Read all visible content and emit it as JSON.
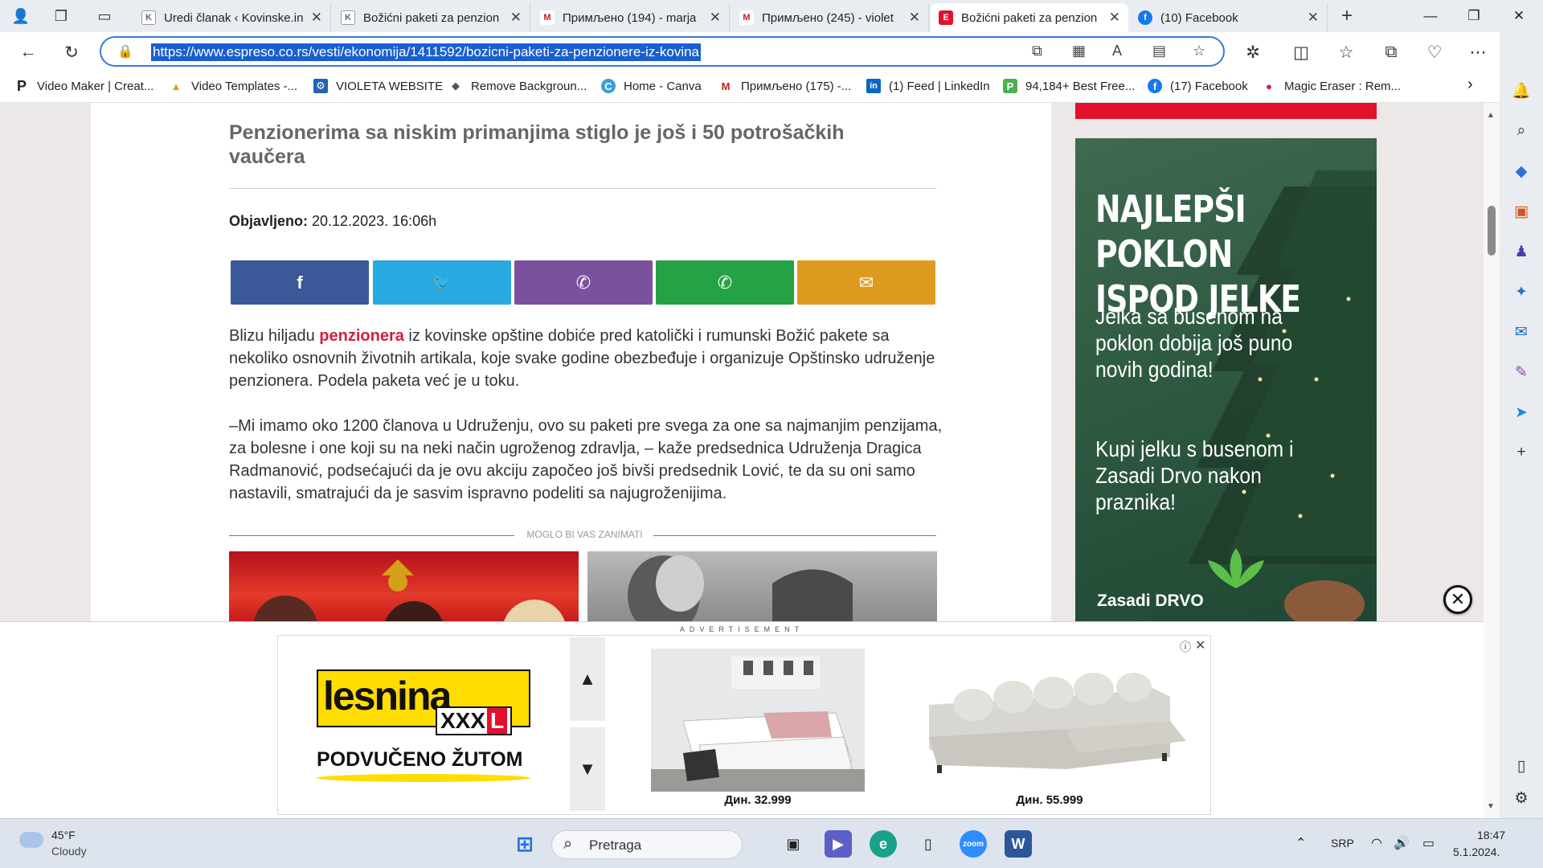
{
  "tabs": [
    {
      "title": "Uredi članak ‹ Kovinske.in",
      "favicon": "K"
    },
    {
      "title": "Božićni paketi za penzion",
      "favicon": "K"
    },
    {
      "title": "Примљено (194) - marja",
      "favicon": "M"
    },
    {
      "title": "Примљено (245) - violet",
      "favicon": "M"
    },
    {
      "title": "Božićni paketi za penzion",
      "favicon": "E",
      "active": true
    },
    {
      "title": "(10) Facebook",
      "favicon": "f"
    }
  ],
  "address": {
    "url": "https://www.espreso.co.rs/vesti/ekonomija/1411592/bozicni-paketi-za-penzionere-iz-kovina"
  },
  "bookmarks": [
    {
      "label": "Video Maker | Creat...",
      "icon": "P"
    },
    {
      "label": "Video Templates -...",
      "icon": "▲"
    },
    {
      "label": "VIOLETA WEBSITE",
      "icon": "⚙"
    },
    {
      "label": "Remove Backgroun...",
      "icon": "◆"
    },
    {
      "label": "Home - Canva",
      "icon": "C"
    },
    {
      "label": "Примљено (175) -...",
      "icon": "M"
    },
    {
      "label": "(1) Feed | LinkedIn",
      "icon": "in"
    },
    {
      "label": "94,184+ Best Free...",
      "icon": "P"
    },
    {
      "label": "(17) Facebook",
      "icon": "f"
    },
    {
      "label": "Magic Eraser : Rem...",
      "icon": "●"
    }
  ],
  "article": {
    "headline": "Penzionerima sa niskim primanjima stiglo je još i 50 potrošačkih vaučera",
    "published_label": "Objavljeno:",
    "published_value": " 20.12.2023. 16:06h",
    "para1_before": "Blizu hiljadu ",
    "para1_link": "penzionera",
    "para1_after": " iz kovinske opštine dobiće pred katolički i rumunski Božić pakete sa nekoliko osnovnih životnih artikala, koje svake godine obezbeđuje i organizuje Opštinsko udruženje penzionera. Podela paketa već je u toku.",
    "para2": "–Mi imamo oko 1200 članova u Udruženju, ovo su paketi pre svega za one sa najmanjim penzijama, za bolesne i one koji su na neki način ugroženog zdravlja, – kaže predsednica Udruženja Dragica Radmanović, podsećajući da je ovu akciju započeo još bivši predsednik Lović, te da su oni samo nastavili, smatrajući da je sasvim ispravno podeliti sa najugroženijima.",
    "related_label": "MOGLO BI VAS ZANIMATI"
  },
  "share": [
    {
      "name": "facebook",
      "glyph": "f",
      "color": "#3b5998"
    },
    {
      "name": "twitter",
      "glyph": "🐦",
      "color": "#28a9e0"
    },
    {
      "name": "viber",
      "glyph": "✆",
      "color": "#7b519d"
    },
    {
      "name": "whatsapp",
      "glyph": "✆",
      "color": "#25a245"
    },
    {
      "name": "email",
      "glyph": "✉",
      "color": "#dc9a1e"
    }
  ],
  "side_ad": {
    "headline": "NAJLEPŠI POKLON ISPOD JELKE",
    "text1": "Jelka sa busenom na poklon dobija još puno novih godina!",
    "text2": "Kupi jelku s busenom i Zasadi Drvo nakon praznika!",
    "brand": "Zasadi DRVO"
  },
  "bottom_ad": {
    "label": "ADVERTISEMENT",
    "brand_word": "lesnina",
    "brand_xxx": "XXX",
    "brand_l": "L",
    "tagline": "PODVUČENO ŽUTOM",
    "price1": "Дин. 32.999",
    "price2": "Дин. 55.999"
  },
  "taskbar": {
    "temp": "45°F",
    "weather": "Cloudy",
    "search": "Pretraga",
    "lang": "SRP",
    "time": "18:47",
    "date": "5.1.2024."
  },
  "colors": {
    "accent": "#d21f3c",
    "url_highlight": "#1a5fd1"
  }
}
